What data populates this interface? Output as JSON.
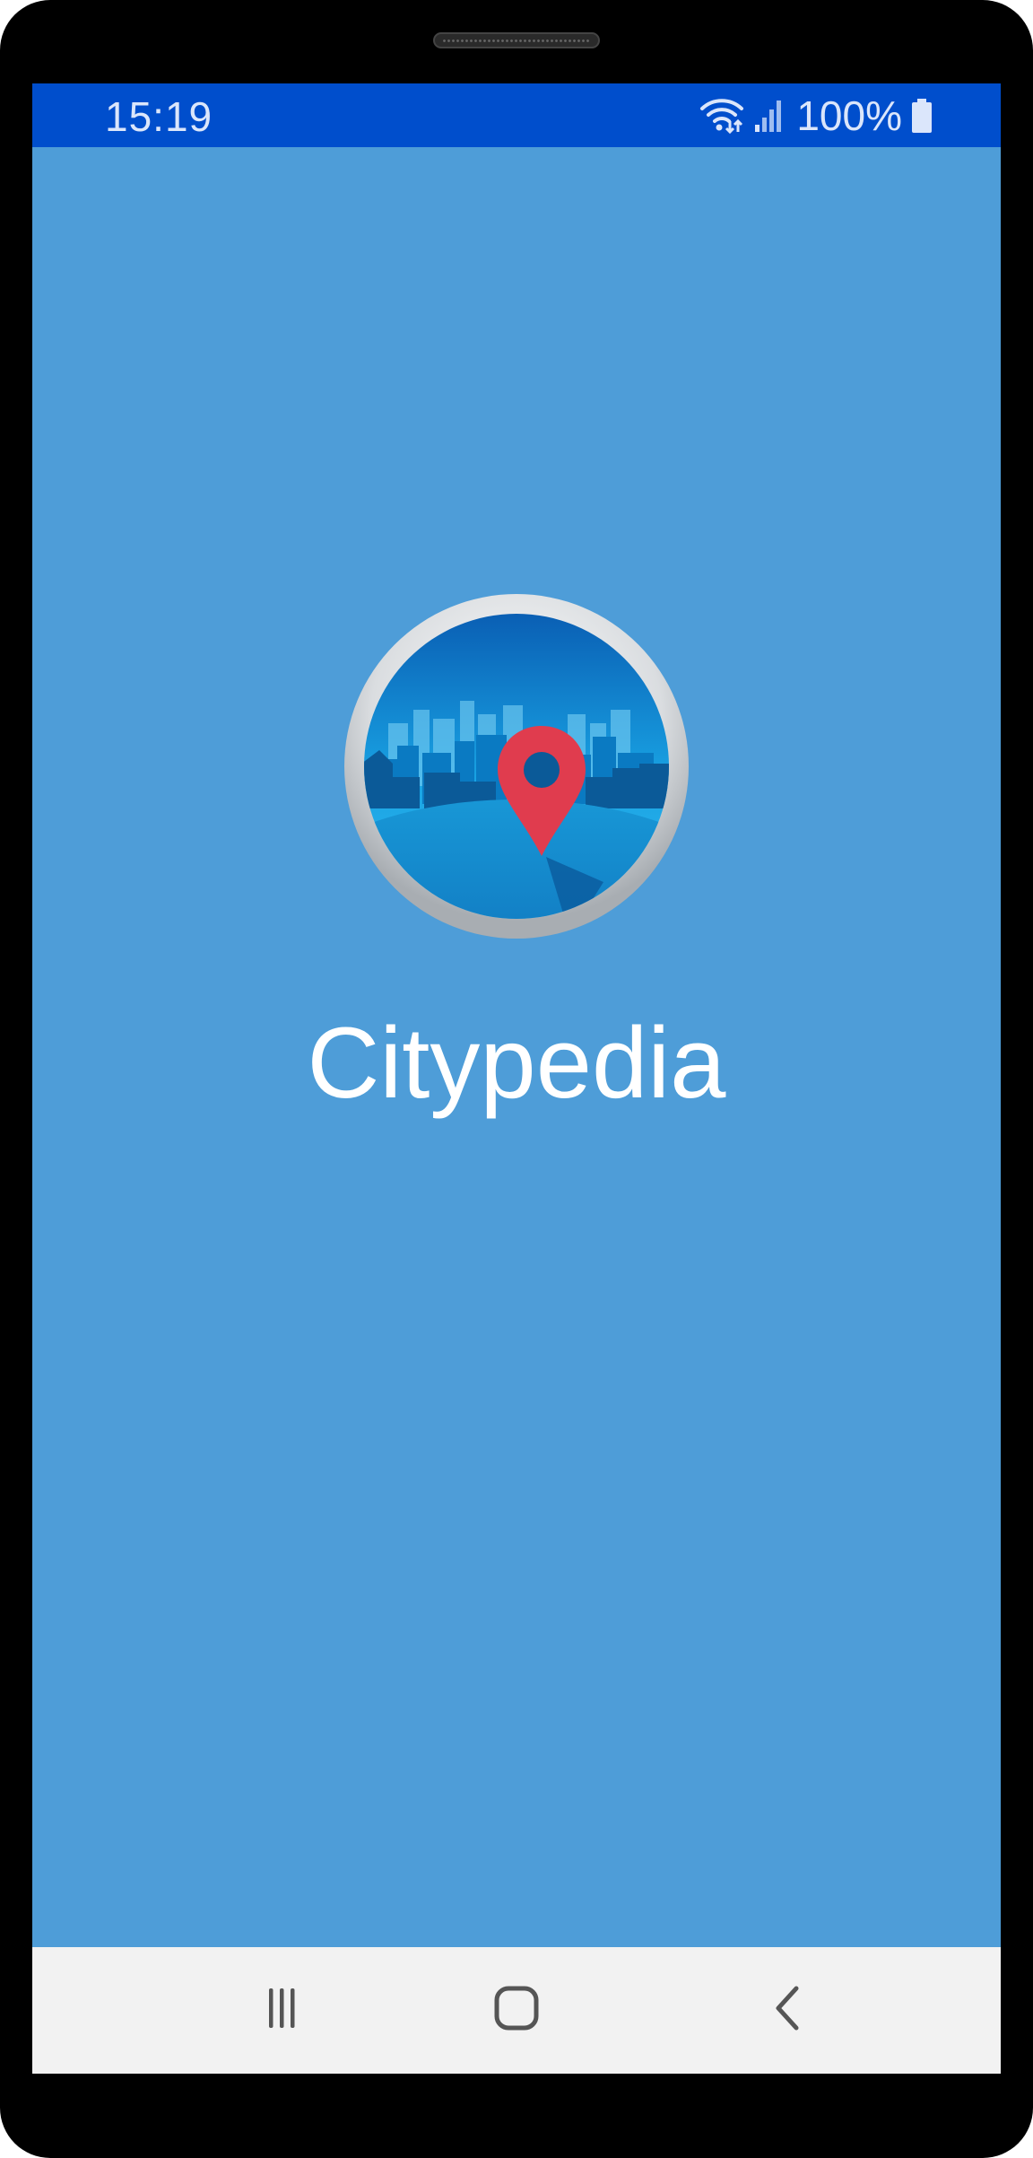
{
  "status_bar": {
    "time": "15:19",
    "battery": "100%",
    "icons": [
      "wifi-icon",
      "signal-icon",
      "battery-icon"
    ]
  },
  "app": {
    "name": "Citypedia",
    "logo_icon": "city-map-pin-logo"
  },
  "nav_bar": {
    "buttons": [
      "recents-icon",
      "home-icon",
      "back-icon"
    ]
  },
  "colors": {
    "status_bar": "#004ecc",
    "splash_background": "#4e9dd8",
    "nav_bar": "#f2f2f2",
    "pin": "#e03c4e"
  }
}
